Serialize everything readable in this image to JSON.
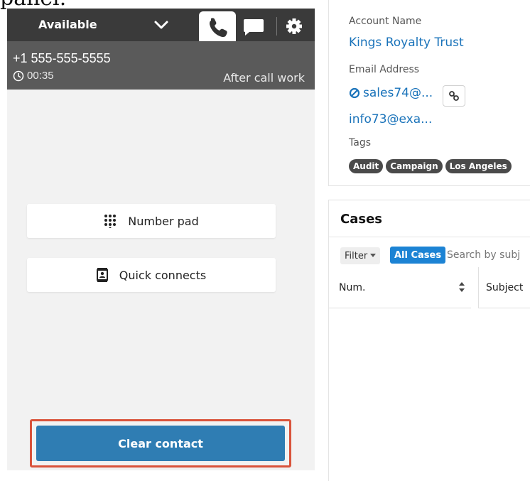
{
  "top_text": "panel.",
  "ccp": {
    "status": "Available",
    "phone_number": "+1 555-555-5555",
    "timer": "00:35",
    "acw_label": "After call work",
    "number_pad_label": "Number pad",
    "quick_connects_label": "Quick connects",
    "clear_contact_label": "Clear contact"
  },
  "details": {
    "account_name_label": "Account Name",
    "account_name": "Kings Royalty Trust",
    "email_label": "Email Address",
    "email_1": "sales74@...",
    "email_2": "info73@exa...",
    "tags_label": "Tags",
    "tags": [
      "Audit",
      "Campaign",
      "Los Angeles"
    ]
  },
  "cases": {
    "title": "Cases",
    "filter_label": "Filter",
    "all_cases_label": "All Cases",
    "search_placeholder": "Search by subj",
    "col_num": "Num.",
    "col_subject": "Subject"
  },
  "colors": {
    "header_bg": "#3a3a3a",
    "contact_bar_bg": "#5a5a5a",
    "clear_button": "#2f7db3",
    "highlight_border": "#d9533b",
    "link": "#1a73ba",
    "all_cases_bg": "#1c83d4"
  },
  "icons": [
    "chevron-down-icon",
    "phone-icon",
    "chat-icon",
    "gear-icon",
    "clock-icon",
    "dialpad-icon",
    "contacts-icon",
    "block-icon",
    "link-icon",
    "sort-icon",
    "caret-down-icon"
  ]
}
